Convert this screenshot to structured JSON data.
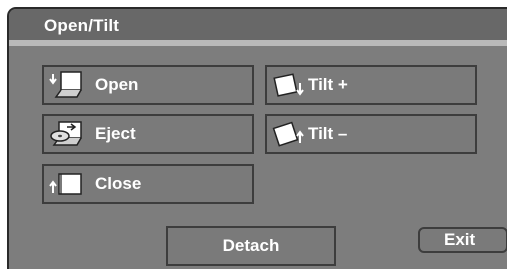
{
  "title": "Open/Tilt",
  "buttons": {
    "open": {
      "label": "Open",
      "icon": "monitor-open-icon"
    },
    "eject": {
      "label": "Eject",
      "icon": "disc-eject-icon"
    },
    "close": {
      "label": "Close",
      "icon": "monitor-close-icon"
    },
    "tilt_plus": {
      "label": "Tilt +",
      "icon": "tilt-up-icon"
    },
    "tilt_minus": {
      "label": "Tilt –",
      "icon": "tilt-down-icon"
    }
  },
  "footer": {
    "detach_label": "Detach",
    "exit_label": "Exit"
  },
  "colors": {
    "background": "#7d7d7d",
    "button": "#7a7a7a",
    "text": "#ffffff"
  }
}
